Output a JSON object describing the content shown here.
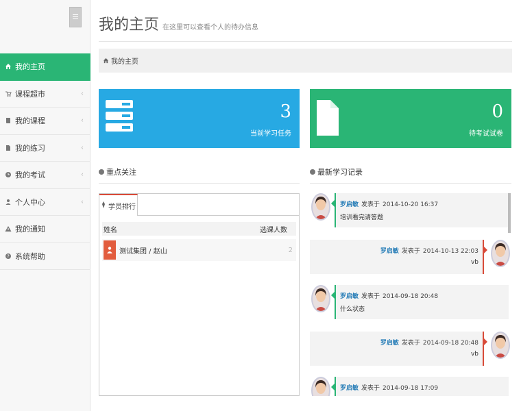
{
  "sidebar": {
    "items": [
      {
        "label": "我的主页",
        "icon": "home-icon",
        "active": true
      },
      {
        "label": "课程超市",
        "icon": "cart-icon"
      },
      {
        "label": "我的课程",
        "icon": "book-icon"
      },
      {
        "label": "我的练习",
        "icon": "file-icon"
      },
      {
        "label": "我的考试",
        "icon": "clock-icon"
      },
      {
        "label": "个人中心",
        "icon": "user-icon"
      },
      {
        "label": "我的通知",
        "icon": "warning-icon"
      },
      {
        "label": "系统帮助",
        "icon": "help-icon"
      }
    ],
    "chevron": "‹"
  },
  "header": {
    "title": "我的主页",
    "subtitle": "在这里可以查看个人的待办信息"
  },
  "breadcrumb": {
    "label": "我的主页"
  },
  "stats": [
    {
      "value": "3",
      "label": "当前学习任务",
      "color": "#27a9e3"
    },
    {
      "value": "0",
      "label": "待考试试卷",
      "color": "#2ab575"
    }
  ],
  "focus": {
    "title": "重点关注",
    "tab": "学员排行",
    "columns": [
      "姓名",
      "选课人数"
    ],
    "rows": [
      {
        "name": "测试集团 / 赵山",
        "count": "2"
      }
    ]
  },
  "feed": {
    "title": "最新学习记录",
    "verb": "发表于",
    "items": [
      {
        "side": "left",
        "user": "罗启敏",
        "time": "2014-10-20 16:37",
        "message": "培训看完请答题"
      },
      {
        "side": "right",
        "user": "罗启敏",
        "time": "2014-10-13 22:03",
        "message": "vb"
      },
      {
        "side": "left",
        "user": "罗启敏",
        "time": "2014-09-18 20:48",
        "message": "什么状态"
      },
      {
        "side": "right",
        "user": "罗启敏",
        "time": "2014-09-18 20:48",
        "message": "vb"
      },
      {
        "side": "left",
        "user": "罗启敏",
        "time": "2014-09-18 17:09",
        "message": ""
      }
    ]
  }
}
